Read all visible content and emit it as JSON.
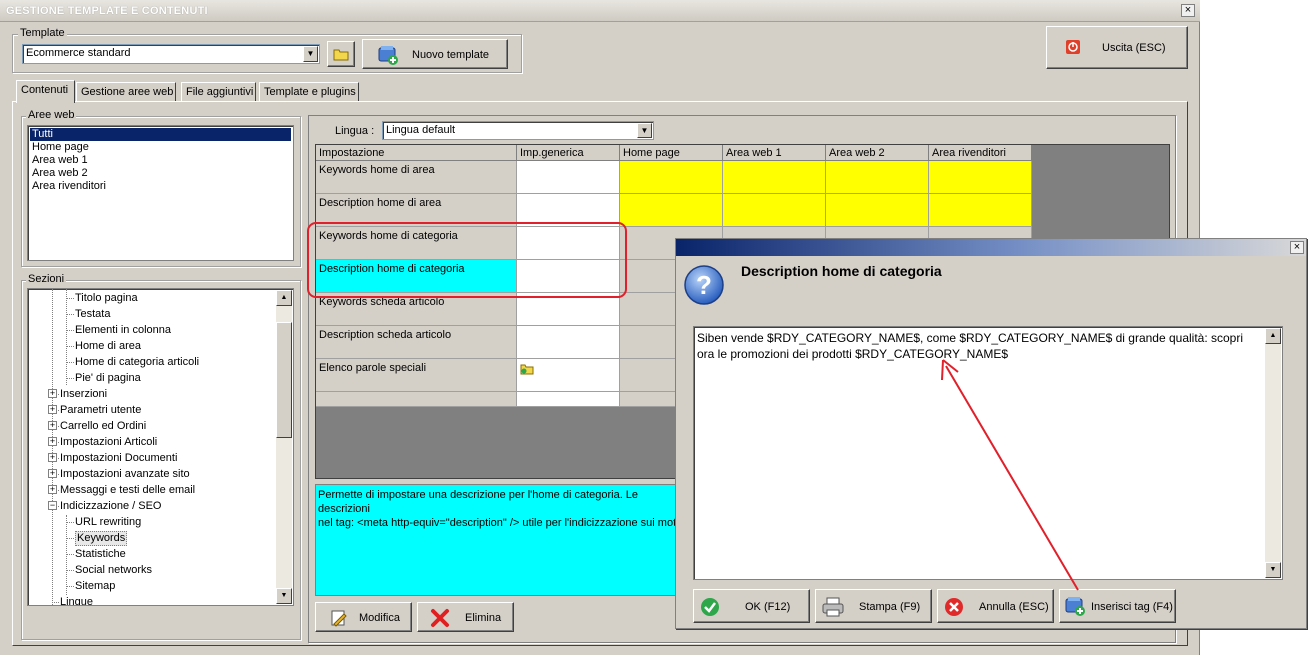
{
  "window": {
    "title": "GESTIONE TEMPLATE E CONTENUTI",
    "close_glyph": "×"
  },
  "template_group": {
    "label": "Template",
    "selected": "Ecommerce standard",
    "new_button": "Nuovo template"
  },
  "exit_button": "Uscita (ESC)",
  "tabs": [
    "Contenuti",
    "Gestione aree web",
    "File aggiuntivi",
    "Template e plugins"
  ],
  "aree_web": {
    "label": "Aree web",
    "items": [
      "Tutti",
      "Home page",
      "Area web 1",
      "Area web 2",
      "Area rivenditori"
    ]
  },
  "sezioni": {
    "label": "Sezioni",
    "items": [
      {
        "label": "Titolo pagina",
        "level": 2
      },
      {
        "label": "Testata",
        "level": 2
      },
      {
        "label": "Elementi in colonna",
        "level": 2
      },
      {
        "label": "Home di area",
        "level": 2
      },
      {
        "label": "Home di categoria articoli",
        "level": 2
      },
      {
        "label": "Pie' di pagina",
        "level": 2
      },
      {
        "label": "Inserzioni",
        "level": 1,
        "expand": "+"
      },
      {
        "label": "Parametri utente",
        "level": 1,
        "expand": "+"
      },
      {
        "label": "Carrello ed Ordini",
        "level": 1,
        "expand": "+"
      },
      {
        "label": "Impostazioni Articoli",
        "level": 1,
        "expand": "+"
      },
      {
        "label": "Impostazioni Documenti",
        "level": 1,
        "expand": "+"
      },
      {
        "label": "Impostazioni avanzate sito",
        "level": 1,
        "expand": "+"
      },
      {
        "label": "Messaggi e testi delle email",
        "level": 1,
        "expand": "+"
      },
      {
        "label": "Indicizzazione / SEO",
        "level": 1,
        "expand": "−"
      },
      {
        "label": "URL rewriting",
        "level": 2
      },
      {
        "label": "Keywords",
        "level": 2,
        "selected": true
      },
      {
        "label": "Statistiche",
        "level": 2
      },
      {
        "label": "Social networks",
        "level": 2
      },
      {
        "label": "Sitemap",
        "level": 2
      },
      {
        "label": "Lingue",
        "level": 1
      }
    ]
  },
  "lingua": {
    "label": "Lingua :",
    "selected": "Lingua default"
  },
  "grid": {
    "headers": [
      "Impostazione",
      "Imp.generica",
      "Home page",
      "Area web 1",
      "Area web 2",
      "Area rivenditori"
    ],
    "rows": [
      {
        "label": "Keywords home di area",
        "yellow": true
      },
      {
        "label": "Description home di area",
        "yellow": true
      },
      {
        "label": "Keywords home di categoria"
      },
      {
        "label": "Description home di categoria",
        "selected": true
      },
      {
        "label": "Keywords scheda articolo"
      },
      {
        "label": "Description scheda articolo"
      },
      {
        "label": "Elenco parole speciali",
        "folder_icon": true
      }
    ],
    "colors": {
      "yellow": "#ffff00",
      "cyan": "#00ffff",
      "gray": "#808080"
    }
  },
  "description": {
    "line1": "Permette di impostare una descrizione per l'home di categoria. Le descrizioni",
    "line2": "nel tag: <meta http-equiv=\"description\" /> utile per l'indicizzazione sui mot"
  },
  "actions": {
    "modifica": "Modifica",
    "elimina": "Elimina"
  },
  "dialog": {
    "title": "Description home di categoria",
    "text": "Siben vende $RDY_CATEGORY_NAME$, come $RDY_CATEGORY_NAME$ di grande qualità: scopri ora le promozioni dei prodotti $RDY_CATEGORY_NAME$",
    "buttons": {
      "ok": "OK (F12)",
      "stampa": "Stampa (F9)",
      "annulla": "Annulla (ESC)",
      "inserisci": "Inserisci tag (F4)"
    }
  },
  "annotation_color": "#e0202a"
}
